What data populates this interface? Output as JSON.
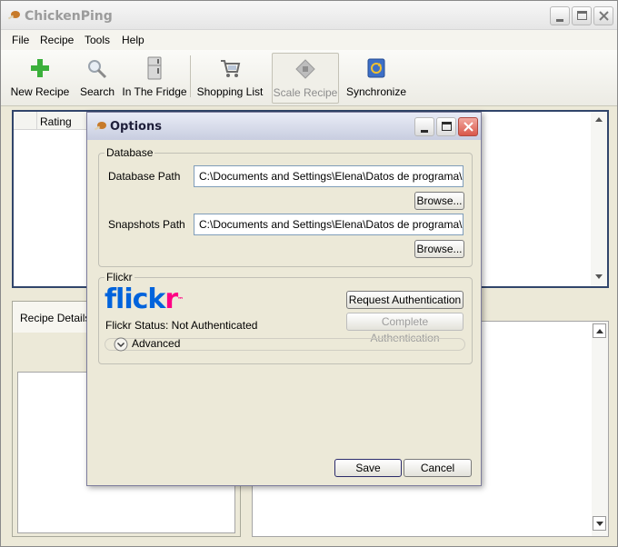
{
  "app": {
    "title": "ChickenPing"
  },
  "menu": [
    "File",
    "Recipe",
    "Tools",
    "Help"
  ],
  "toolbar": {
    "new_recipe": "New Recipe",
    "search": "Search",
    "in_the_fridge": "In The Fridge",
    "shopping_list": "Shopping List",
    "scale_recipe": "Scale Recipe",
    "synchronize": "Synchronize"
  },
  "recipe_list": {
    "column_rating": "Rating"
  },
  "details": {
    "tab_recipe_details": "Recipe Details"
  },
  "dialog": {
    "title": "Options",
    "database": {
      "legend": "Database",
      "database_path_label": "Database Path",
      "database_path_value": "C:\\Documents and Settings\\Elena\\Datos de programa\\Ch",
      "snapshots_path_label": "Snapshots Path",
      "snapshots_path_value": "C:\\Documents and Settings\\Elena\\Datos de programa\\Ch",
      "browse_label": "Browse..."
    },
    "flickr": {
      "legend": "Flickr",
      "logo_text": "flickr",
      "status": "Flickr Status: Not Authenticated",
      "advanced": "Advanced",
      "request_auth": "Request Authentication",
      "complete_auth": "Complete Authentication"
    },
    "save_label": "Save",
    "cancel_label": "Cancel"
  },
  "colors": {
    "flickr_blue": "#0063dc",
    "flickr_pink": "#ff0084",
    "dialog_border": "#7c7c9c"
  }
}
